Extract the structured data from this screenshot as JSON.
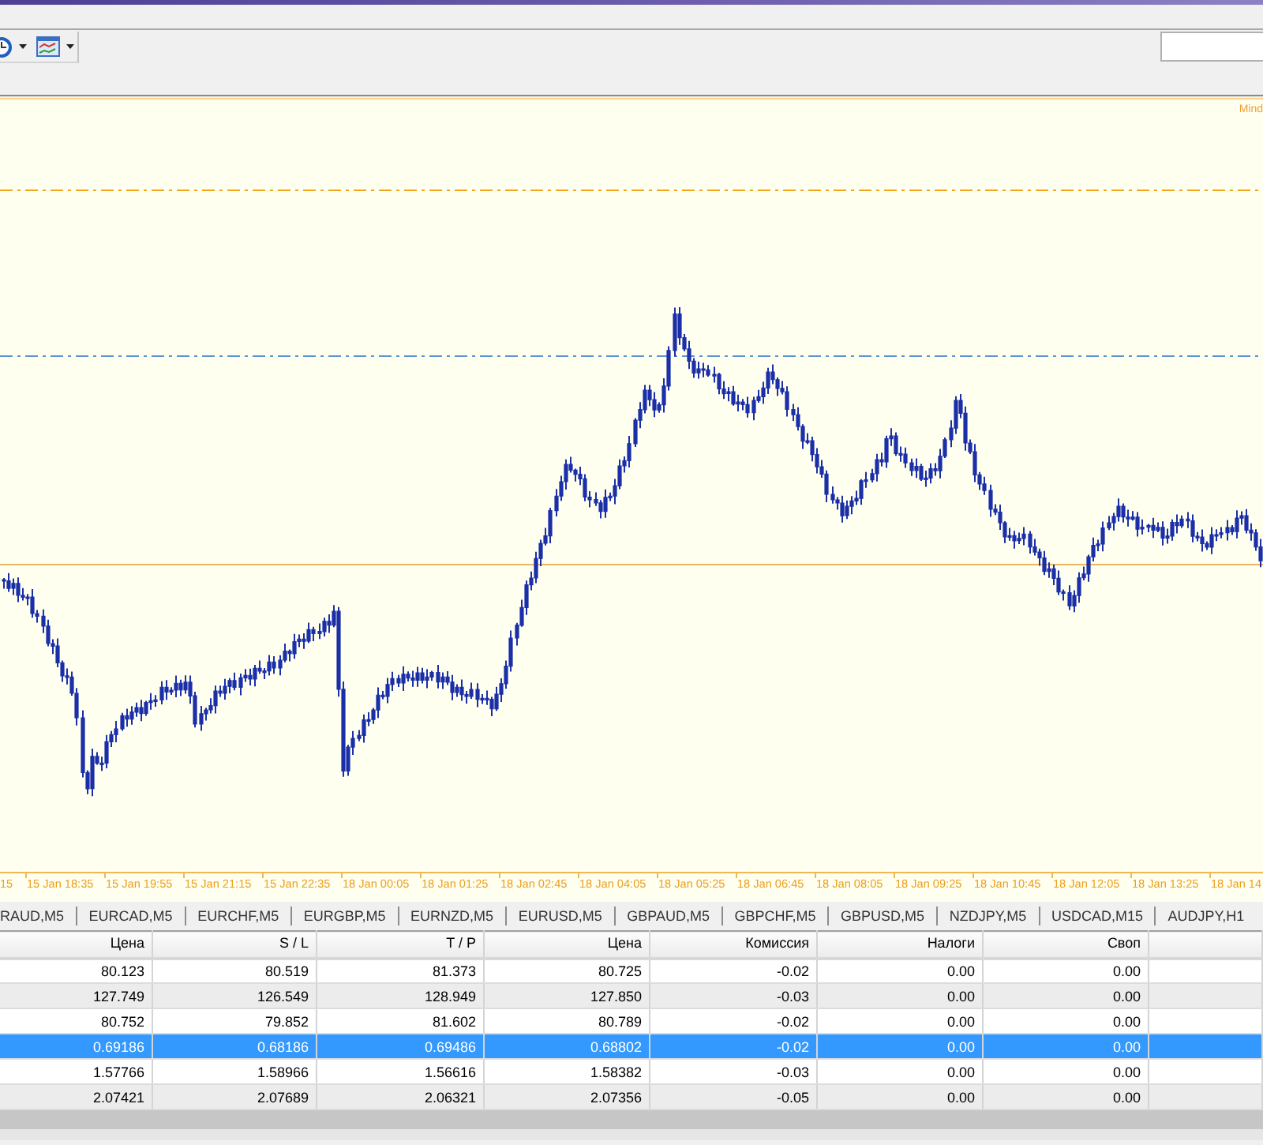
{
  "chart": {
    "corner_label": "Mind",
    "time_axis": [
      "15",
      "15 Jan 18:35",
      "15 Jan 19:55",
      "15 Jan 21:15",
      "15 Jan 22:35",
      "18 Jan 00:05",
      "18 Jan 01:25",
      "18 Jan 02:45",
      "18 Jan 04:05",
      "18 Jan 05:25",
      "18 Jan 06:45",
      "18 Jan 08:05",
      "18 Jan 09:25",
      "18 Jan 10:45",
      "18 Jan 12:05",
      "18 Jan 13:25",
      "18 Jan 14"
    ]
  },
  "symbol_tabs": [
    {
      "label": "RAUD,M5",
      "selected": false
    },
    {
      "label": "EURCAD,M5",
      "selected": false
    },
    {
      "label": "EURCHF,M5",
      "selected": false
    },
    {
      "label": "EURGBP,M5",
      "selected": false
    },
    {
      "label": "EURNZD,M5",
      "selected": false
    },
    {
      "label": "EURUSD,M5",
      "selected": false
    },
    {
      "label": "GBPAUD,M5",
      "selected": false
    },
    {
      "label": "GBPCHF,M5",
      "selected": false
    },
    {
      "label": "GBPUSD,M5",
      "selected": false
    },
    {
      "label": "NZDJPY,M5",
      "selected": false
    },
    {
      "label": "USDCAD,M15",
      "selected": false
    },
    {
      "label": "AUDJPY,H1",
      "selected": false
    }
  ],
  "table": {
    "columns": [
      "Цена",
      "S / L",
      "T / P",
      "Цена",
      "Комиссия",
      "Налоги",
      "Своп"
    ],
    "rows": [
      {
        "cells": [
          "80.123",
          "80.519",
          "81.373",
          "80.725",
          "-0.02",
          "0.00",
          "0.00"
        ],
        "selected": false
      },
      {
        "cells": [
          "127.749",
          "126.549",
          "128.949",
          "127.850",
          "-0.03",
          "0.00",
          "0.00"
        ],
        "selected": false
      },
      {
        "cells": [
          "80.752",
          "79.852",
          "81.602",
          "80.789",
          "-0.02",
          "0.00",
          "0.00"
        ],
        "selected": false
      },
      {
        "cells": [
          "0.69186",
          "0.68186",
          "0.69486",
          "0.68802",
          "-0.02",
          "0.00",
          "0.00"
        ],
        "selected": true
      },
      {
        "cells": [
          "1.57766",
          "1.58966",
          "1.56616",
          "1.58382",
          "-0.03",
          "0.00",
          "0.00"
        ],
        "selected": false
      },
      {
        "cells": [
          "2.07421",
          "2.07689",
          "2.06321",
          "2.07356",
          "-0.05",
          "0.00",
          "0.00"
        ],
        "selected": false
      }
    ]
  }
}
